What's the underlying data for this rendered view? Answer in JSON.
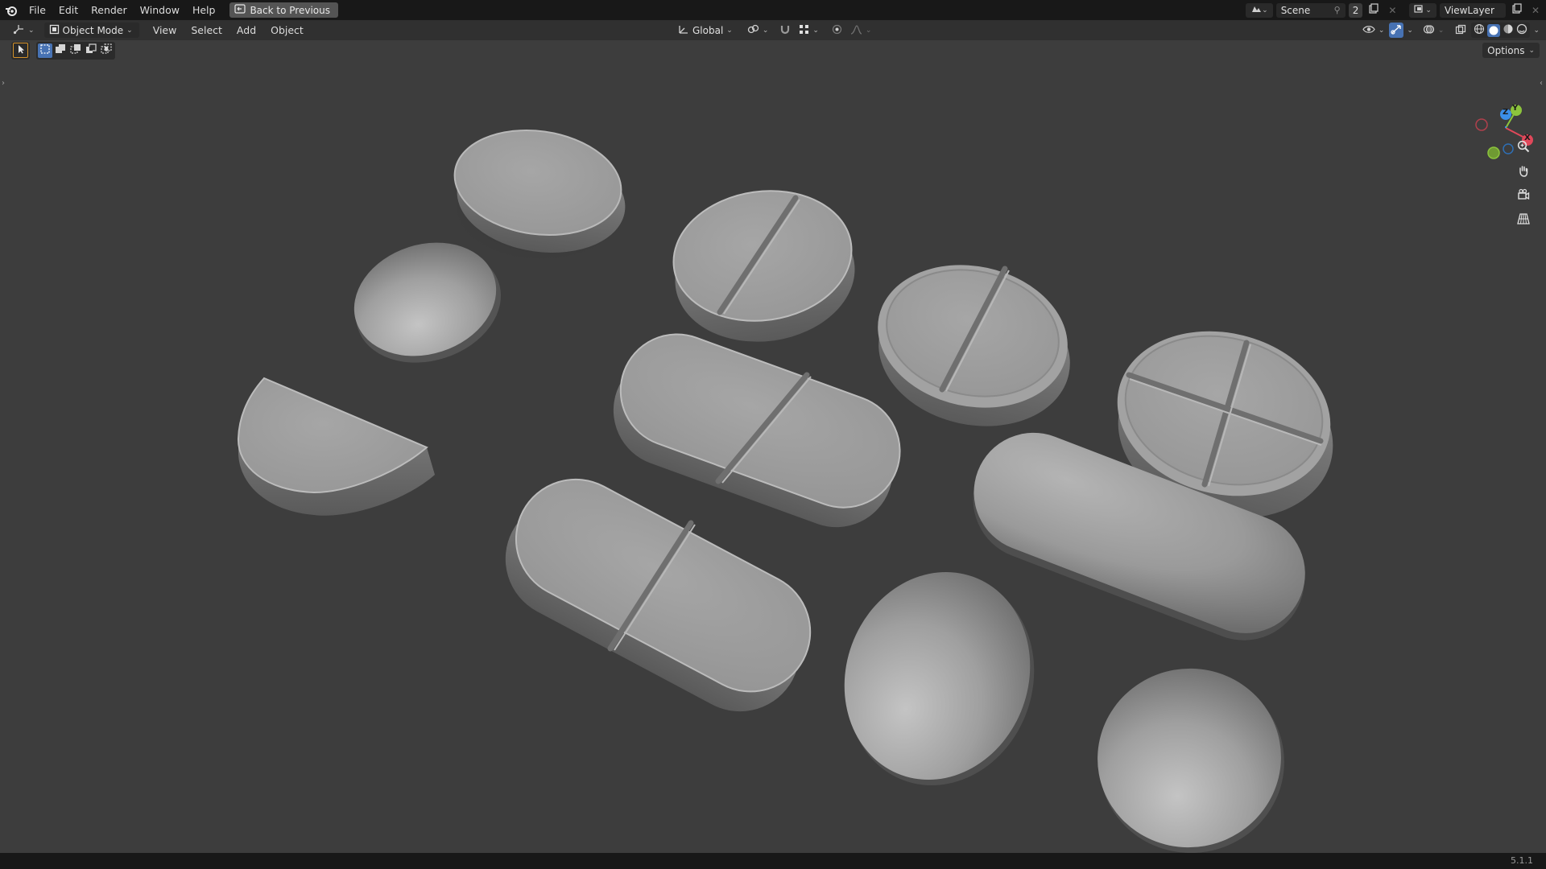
{
  "menu": {
    "items": [
      "File",
      "Edit",
      "Render",
      "Window",
      "Help"
    ],
    "back_button": "Back to Previous"
  },
  "top_right": {
    "scene_label": "Scene",
    "scene_users": "2",
    "view_layer_label": "ViewLayer"
  },
  "header": {
    "mode": "Object Mode",
    "menus": [
      "View",
      "Select",
      "Add",
      "Object"
    ],
    "transform_orientation": "Global"
  },
  "toolbar": {
    "options_label": "Options"
  },
  "gizmo": {
    "x_label": "X",
    "y_label": "Y",
    "z_label": "Z",
    "x_color": "#e0485a",
    "y_color": "#8cc43c",
    "z_color": "#3b8fe8"
  },
  "status": {
    "version": "5.1.1"
  },
  "colors": {
    "accent": "#4772b3",
    "viewport_bg": "#3d3d3d",
    "topbar_bg": "#181818",
    "header_bg": "#303030"
  }
}
